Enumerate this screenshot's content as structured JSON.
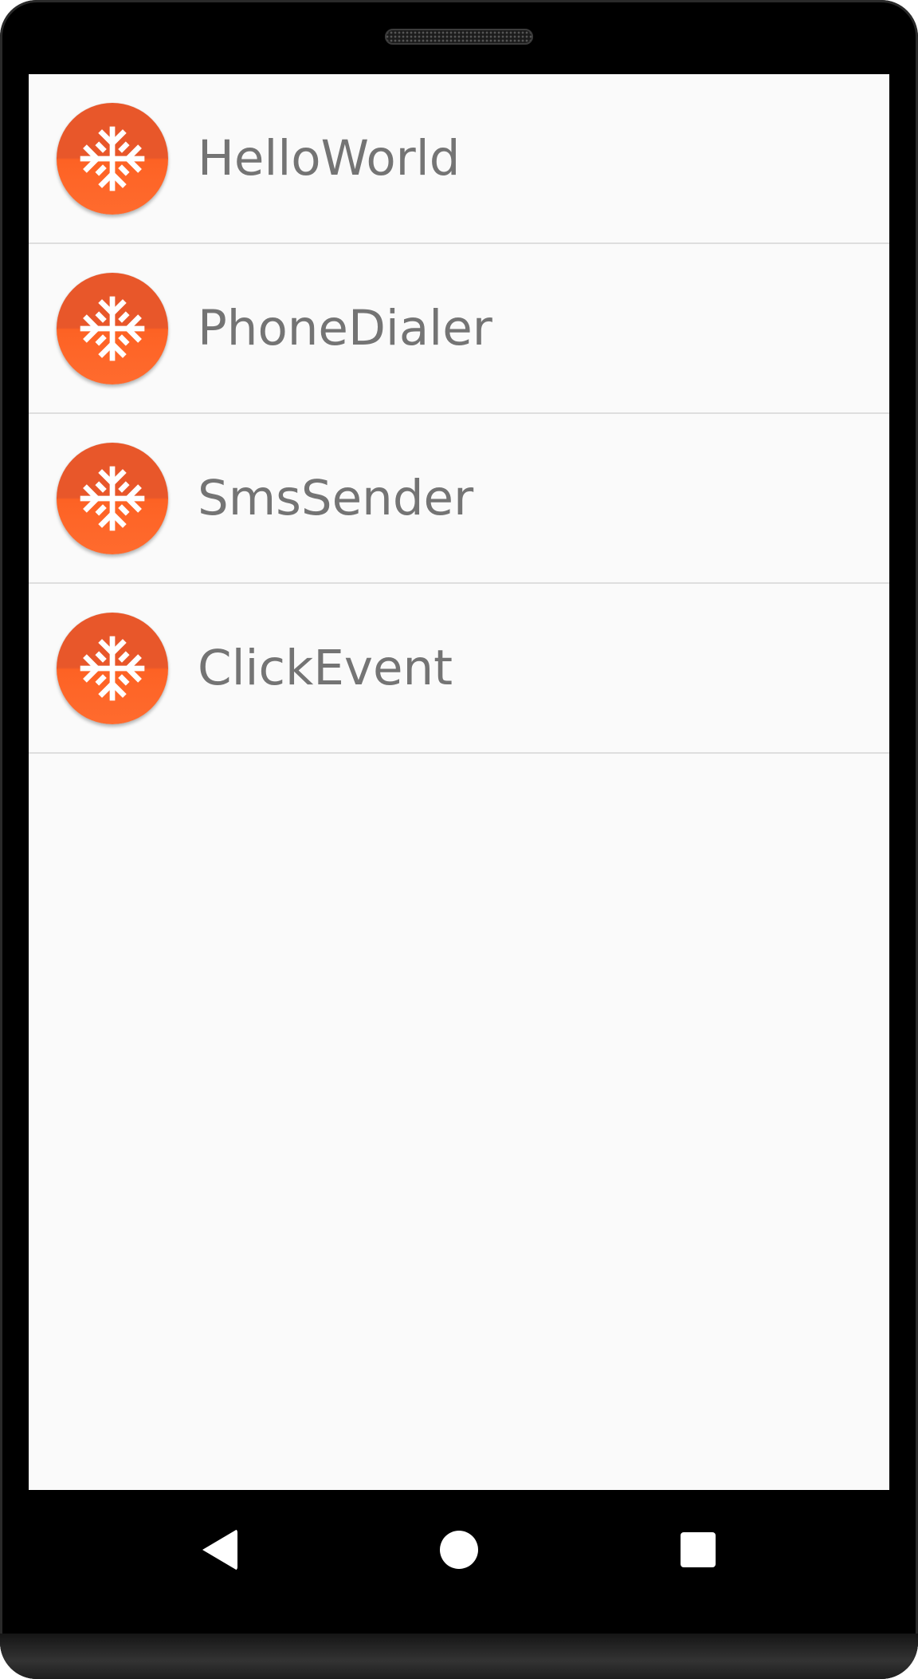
{
  "app_list": {
    "items": [
      {
        "label": "HelloWorld",
        "icon": "snowflake-icon"
      },
      {
        "label": "PhoneDialer",
        "icon": "snowflake-icon"
      },
      {
        "label": "SmsSender",
        "icon": "snowflake-icon"
      },
      {
        "label": "ClickEvent",
        "icon": "snowflake-icon"
      }
    ]
  },
  "nav_bar": {
    "back_icon": "back-triangle-icon",
    "home_icon": "home-circle-icon",
    "recents_icon": "recents-square-icon"
  },
  "colors": {
    "icon_background_top": "#e8572a",
    "icon_background_bottom": "#ff6b2e",
    "icon_glyph": "#ffffff",
    "label_text": "#747474",
    "list_background": "#fafafa",
    "divider": "#dedede",
    "device_frame": "#000000"
  }
}
